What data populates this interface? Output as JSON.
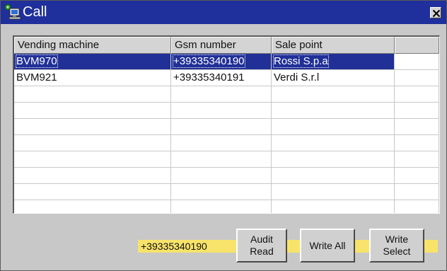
{
  "window": {
    "title": "Call",
    "icon": "phone-computer-icon",
    "close_icon": "close-icon"
  },
  "grid": {
    "columns": [
      "Vending machine",
      "Gsm number",
      "Sale point",
      ""
    ],
    "rows": [
      {
        "machine": "BVM970",
        "gsm": "+39335340190",
        "sale_point": "Rossi S.p.a",
        "selected": true
      },
      {
        "machine": "BVM921",
        "gsm": "+39335340191",
        "sale_point": "Verdi S.r.l",
        "selected": false
      }
    ],
    "empty_row_count": 8
  },
  "footer": {
    "gsm_number": "+39335340190",
    "buttons": {
      "audit_read": "Audit\nRead",
      "write_all": "Write  All",
      "write_select": "Write\nSelect"
    }
  },
  "colors": {
    "title_bar": "#1f2f9c",
    "selection": "#213097",
    "highlight_strip": "#f8e36a",
    "window_bg": "#c8c8c8"
  }
}
